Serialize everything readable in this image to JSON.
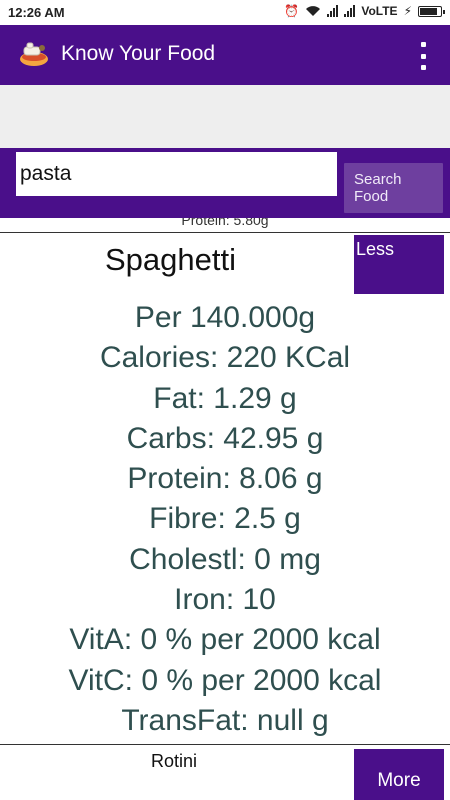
{
  "status_bar": {
    "time": "12:26 AM",
    "network": "VoLTE",
    "battery_level": 0.95,
    "icons": [
      "alarm-icon",
      "wifi-icon",
      "signal-icon",
      "signal-icon",
      "battery-icon",
      "charging-icon"
    ]
  },
  "app_bar": {
    "title": "Know Your Food",
    "logo_icon": "food-logo-icon",
    "menu_icon": "overflow-menu-icon"
  },
  "search": {
    "value": "pasta",
    "button_label": "Search Food"
  },
  "results": {
    "previous_partial_text": "Protein: 5.80g",
    "expanded_item": {
      "name": "Spaghetti",
      "toggle_label": "Less",
      "details": [
        "Per 140.000g",
        "Calories: 220 KCal",
        "Fat: 1.29 g",
        "Carbs: 42.95 g",
        "Protein: 8.06 g",
        "Fibre: 2.5 g",
        "Cholestl: 0 mg",
        "Iron: 10",
        "VitA: 0 % per 2000 kcal",
        "VitC: 0 % per 2000 kcal",
        "TransFat: null g"
      ]
    },
    "next_item": {
      "name": "Rotini",
      "toggle_label": "More"
    }
  },
  "colors": {
    "primary": "#4a0f8a",
    "search_button": "#6e3f9f",
    "detail_text": "#2f4f4f",
    "grey_band": "#eeeeee"
  }
}
